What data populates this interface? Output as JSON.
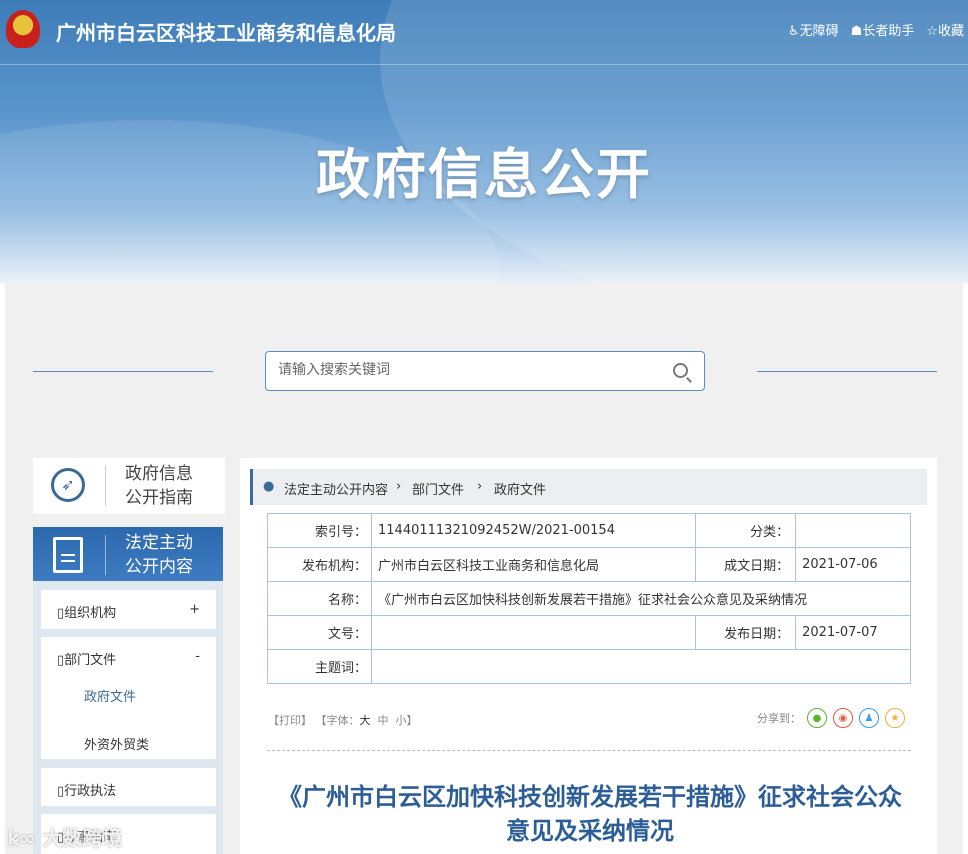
{
  "header": {
    "site_title": "广州市白云区科技工业商务和信息化局",
    "links": [
      "无障碍",
      "长者助手",
      "收藏"
    ],
    "banner_title": "政府信息公开"
  },
  "search": {
    "placeholder": "请输入搜索关键词"
  },
  "sidebar": {
    "guide": [
      "政府信息",
      "公开指南"
    ],
    "legal": [
      "法定主动",
      "公开内容"
    ],
    "items": [
      {
        "label": "组织机构",
        "toggle": "+"
      },
      {
        "label": "部门文件",
        "toggle": "-",
        "children": [
          "政府文件",
          "外资外贸类"
        ]
      },
      {
        "label": "行政执法"
      },
      {
        "label": "办事指南"
      }
    ]
  },
  "breadcrumb": [
    "法定主动公开内容",
    "部门文件",
    "政府文件"
  ],
  "meta": {
    "index_label": "索引号：",
    "index": "11440111321092452W/2021-00154",
    "category_label": "分类：",
    "category": "",
    "publisher_label": "发布机构：",
    "publisher": "广州市白云区科技工业商务和信息化局",
    "written_label": "成文日期：",
    "written": "2021-07-06",
    "name_label": "名称：",
    "name": "《广州市白云区加快科技创新发展若干措施》征求社会公众意见及采纳情况",
    "docno_label": "文号：",
    "docno": "",
    "pubdate_label": "发布日期：",
    "pubdate": "2021-07-07",
    "subject_label": "主题词：",
    "subject": ""
  },
  "tools": {
    "print": "【打印】",
    "font": "【字体：",
    "large": "大",
    "medium": "中",
    "small": "小",
    "close": "】",
    "share": "分享到："
  },
  "article": {
    "title": "《广州市白云区加快科技创新发展若干措施》征求社会公众意见及采纳情况"
  },
  "watermark": "大数跨境",
  "colors": {
    "accent": "#2c68ad",
    "title": "#2d5d97"
  }
}
